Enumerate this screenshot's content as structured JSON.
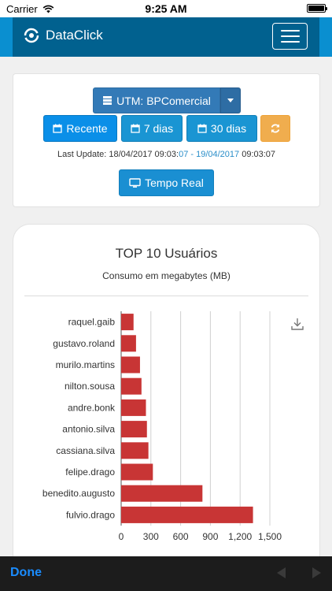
{
  "status_bar": {
    "carrier": "Carrier",
    "time": "9:25 AM",
    "wifi_icon": "wifi-icon",
    "battery_icon": "battery-icon"
  },
  "navbar": {
    "brand": "DataClick",
    "logo_icon": "dataclick-logo-icon",
    "menu_icon": "hamburger-menu-icon"
  },
  "filters": {
    "utm_label": "UTM: BPComercial",
    "utm_icon": "server-icon",
    "periods": [
      {
        "label": "Recente",
        "icon": "calendar-icon",
        "active": true
      },
      {
        "label": "7 dias",
        "icon": "calendar-icon",
        "active": false
      },
      {
        "label": "30 dias",
        "icon": "calendar-icon",
        "active": false
      }
    ],
    "refresh_icon": "refresh-icon",
    "last_update": {
      "prefix": "Last Update: 18/04/2017 09:03:",
      "hl1": "07 - 19/04/2017",
      "suffix": " 09:03:07"
    },
    "realtime_label": "Tempo Real",
    "realtime_icon": "monitor-icon"
  },
  "chart": {
    "download_icon": "download-icon",
    "accent_color": "#c83535"
  },
  "chart_data": {
    "type": "bar",
    "orientation": "horizontal",
    "title": "TOP 10 Usuários",
    "subtitle": "Consumo em megabytes (MB)",
    "categories": [
      "raquel.gaib",
      "gustavo.roland",
      "murilo.martins",
      "nilton.sousa",
      "andre.bonk",
      "antonio.silva",
      "cassiana.silva",
      "felipe.drago",
      "benedito.augusto",
      "fulvio.drago"
    ],
    "values": [
      125,
      150,
      190,
      205,
      250,
      260,
      275,
      320,
      820,
      1330
    ],
    "xlim": [
      0,
      1500
    ],
    "xticks": [
      "0",
      "300",
      "600",
      "900",
      "1,200",
      "1,500"
    ],
    "xtick_values": [
      0,
      300,
      600,
      900,
      1200,
      1500
    ],
    "grid": true
  },
  "toolbar": {
    "done_label": "Done",
    "back_icon": "back-arrow-icon",
    "forward_icon": "forward-arrow-icon"
  }
}
